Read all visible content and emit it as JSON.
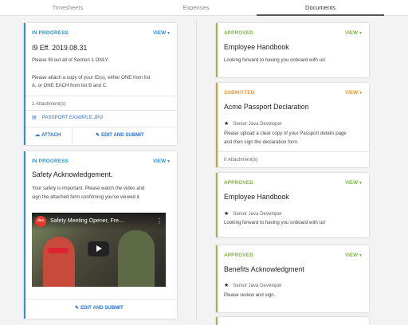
{
  "tabs": [
    {
      "label": "Timesheets"
    },
    {
      "label": "Expenses"
    },
    {
      "label": "Documents",
      "active": true
    }
  ],
  "colors": {
    "in_progress": "#2a8fd7",
    "approved": "#8bc34a",
    "submitted": "#f0932d",
    "link": "#2a6fd7"
  },
  "left_cards": [
    {
      "status": "IN PROGRESS",
      "view": "VIEW",
      "title": "I9 Eff. 2019.08.31",
      "body_1": "Please fill out all of Section 1 ONLY.",
      "body_2": "Please attach a copy of your ID(s), either ONE from list",
      "body_3": "A, or ONE EACH from list B and C.",
      "attachments": "1 Attachment(s)",
      "file": "PASSPORT EXAMPLE.JPG",
      "attach_label": "ATTACH",
      "edit_label": "EDIT AND SUBMIT"
    },
    {
      "status": "IN PROGRESS",
      "view": "VIEW",
      "title": "Safety Acknowledgement.",
      "body_1": "Your safety is important. Please watch the video and",
      "body_2": "sign the attached form confirming you've viewed it.",
      "video_logo": "dss",
      "video_title": "Safety Meeting Opener, Fre...",
      "edit_label": "EDIT AND SUBMIT"
    }
  ],
  "right_cards": [
    {
      "status": "APPROVED",
      "view": "VIEW",
      "title": "Employee Handbook",
      "body_1": "Looking forward to having you onboard with us!"
    },
    {
      "status": "SUBMITTED",
      "view": "VIEW",
      "title": "Acme Passport Declaration",
      "role": "Senior Java Developer",
      "body_1": "Please upload a clear copy of your Passport details page",
      "body_2": "and then sign the declaration form.",
      "attachments": "0 Attachment(s)"
    },
    {
      "status": "APPROVED",
      "view": "VIEW",
      "title": "Employee Handbook",
      "role": "Senior Java Developer",
      "body_1": "Looking forward to having you onboard with us!"
    },
    {
      "status": "APPROVED",
      "view": "VIEW",
      "title": "Benefits Acknowledgment",
      "role": "Senior Java Developer",
      "body_1": "Please review and sign."
    }
  ]
}
